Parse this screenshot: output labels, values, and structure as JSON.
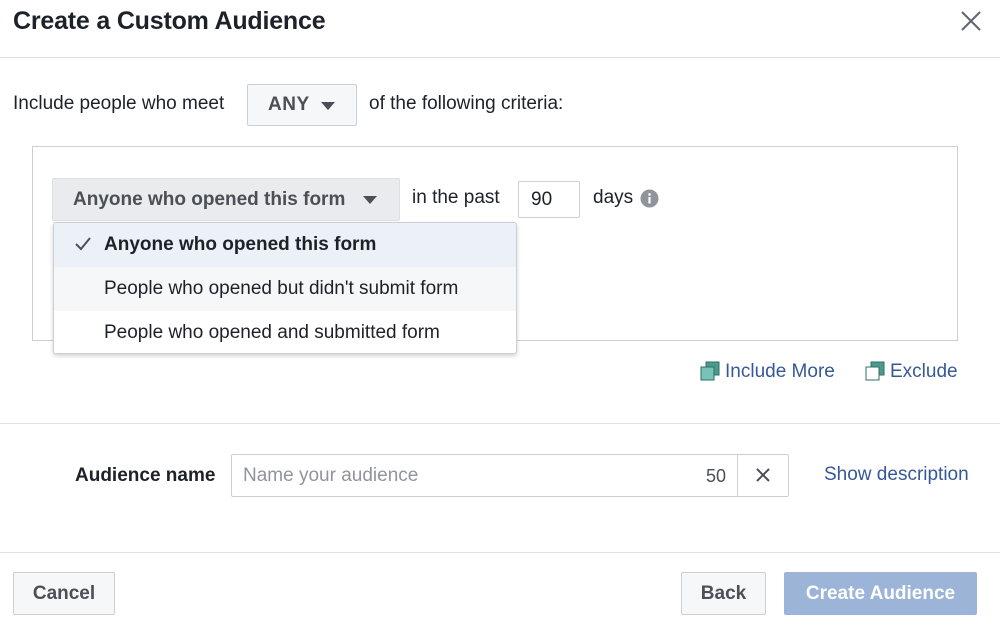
{
  "dialog": {
    "title": "Create a Custom Audience",
    "close_icon": "close-icon"
  },
  "criteria": {
    "prefix": "Include people who meet",
    "match_value": "ANY",
    "suffix": "of the following criteria:"
  },
  "rule": {
    "event_selected": "Anyone who opened this form",
    "past_label": "in the past",
    "days_value": "90",
    "days_label": "days",
    "info_icon": "info-icon"
  },
  "dropdown": {
    "items": [
      {
        "label": "Anyone who opened this form",
        "selected": true
      },
      {
        "label": "People who opened but didn't submit form",
        "selected": false
      },
      {
        "label": "People who opened and submitted form",
        "selected": false
      }
    ]
  },
  "actions": {
    "include_more": "Include More",
    "exclude": "Exclude"
  },
  "audience_name": {
    "label": "Audience name",
    "placeholder": "Name your audience",
    "value": "",
    "char_remaining": "50",
    "show_description": "Show description"
  },
  "footer": {
    "cancel": "Cancel",
    "back": "Back",
    "create": "Create Audience"
  },
  "colors": {
    "link": "#365899",
    "primary_disabled": "#9cb4d8",
    "icon_teal": "#4a9a8e"
  }
}
